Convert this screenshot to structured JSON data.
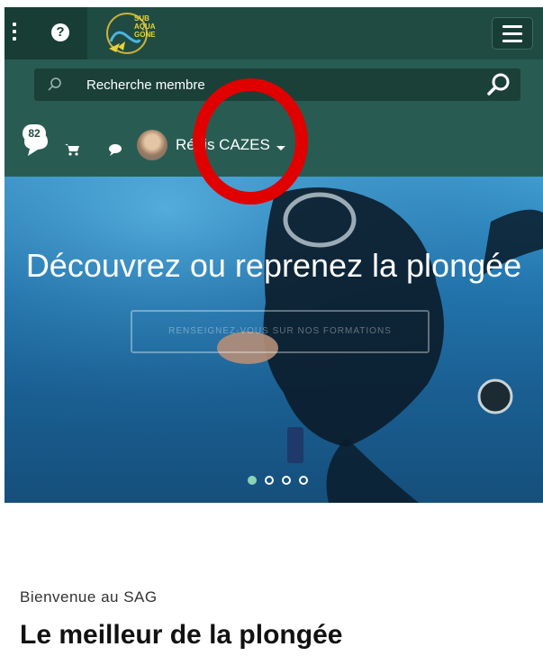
{
  "topbar": {
    "logo_text": [
      "SUB",
      "AQUA",
      "GONE"
    ],
    "help_label": "?"
  },
  "search": {
    "placeholder": "Recherche membre"
  },
  "user_bar": {
    "notification_count": "82",
    "user_name": "Régis CAZES"
  },
  "hero": {
    "title": "Découvrez ou reprenez la plongée",
    "cta_label": "RENSEIGNEZ-VOUS SUR NOS FORMATIONS",
    "slides_total": 4,
    "active_slide": 1
  },
  "content": {
    "welcome": "Bienvenue au SAG",
    "title": "Le meilleur de la plongée"
  },
  "colors": {
    "header_dark": "#173d35",
    "header": "#1f4b42",
    "search_area": "#285c52",
    "accent": "#8bd2b6",
    "annotation": "#e00000"
  }
}
